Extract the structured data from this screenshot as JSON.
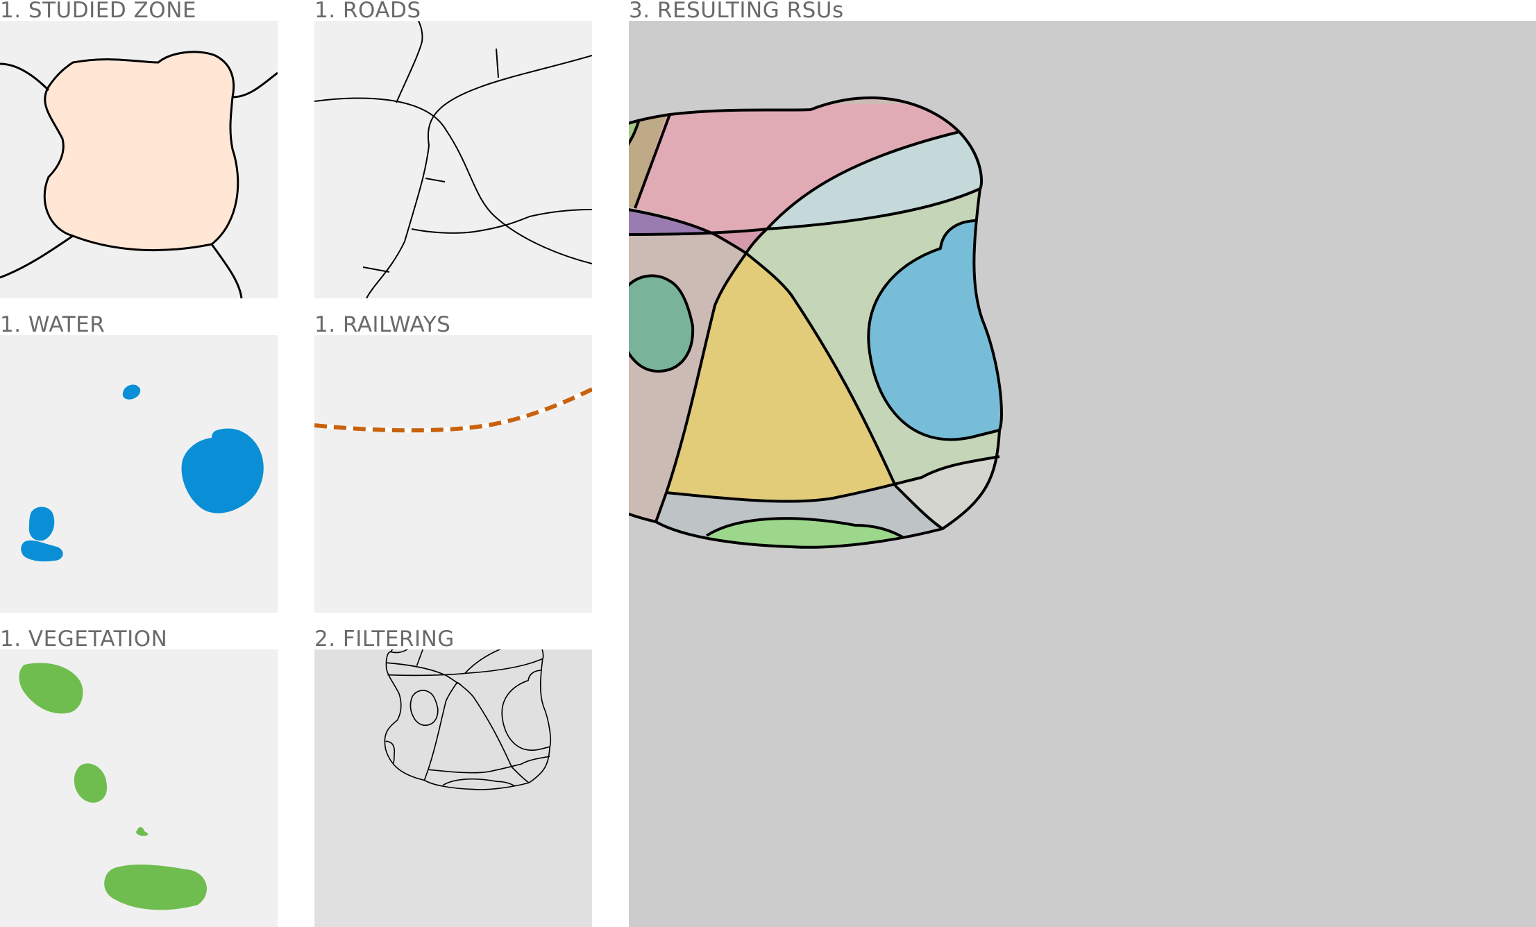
{
  "panels": [
    {
      "id": "studied-zone",
      "title": "1. STUDIED ZONE"
    },
    {
      "id": "roads",
      "title": "1. ROADS"
    },
    {
      "id": "water",
      "title": "1. WATER"
    },
    {
      "id": "railways",
      "title": "1. RAILWAYS"
    },
    {
      "id": "vegetation",
      "title": "1. VEGETATION"
    },
    {
      "id": "filtering",
      "title": "2. FILTERING"
    },
    {
      "id": "resulting-rsus",
      "title": "3. RESULTING RSUs"
    }
  ],
  "colors": {
    "panel_bg": "#f0f0f0",
    "filter_bg": "#e0e0e0",
    "result_bg": "#cccccc",
    "zone_fill": "#ffe6d5",
    "water": "#0a8fd6",
    "vegetation": "#6fbd4f",
    "railway": "#c8620c"
  }
}
